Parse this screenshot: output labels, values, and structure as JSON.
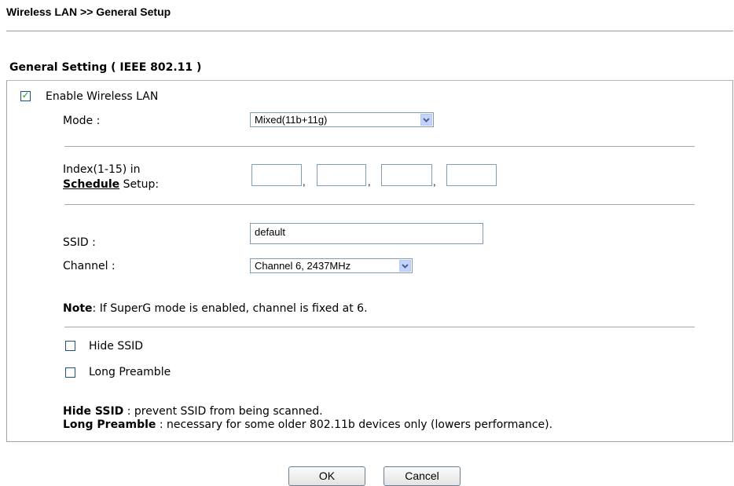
{
  "breadcrumb": "Wireless LAN >> General Setup",
  "section_title": "General Setting ( IEEE 802.11 )",
  "enable_wlan": {
    "label": "Enable Wireless LAN",
    "checked": true
  },
  "mode": {
    "label": "Mode :",
    "value": "Mixed(11b+11g)"
  },
  "schedule": {
    "label_line1": "Index(1-15) in",
    "label_link": "Schedule",
    "label_rest": " Setup:",
    "indexes": [
      "",
      "",
      "",
      ""
    ],
    "separator": ","
  },
  "ssid": {
    "label": "SSID :",
    "value": "default"
  },
  "channel": {
    "label": "Channel :",
    "value": "Channel 6, 2437MHz"
  },
  "note": {
    "bold": "Note",
    "text": ": If SuperG mode is enabled, channel is fixed at 6."
  },
  "hide_ssid": {
    "label": "Hide SSID",
    "checked": false
  },
  "long_preamble": {
    "label": "Long Preamble",
    "checked": false
  },
  "help": {
    "hide_ssid_term": "Hide SSID",
    "hide_ssid_desc": " : prevent SSID from being scanned.",
    "long_preamble_term": "Long Preamble",
    "long_preamble_desc": " : necessary for some older 802.11b devices only (lowers performance)."
  },
  "buttons": {
    "ok": "OK",
    "cancel": "Cancel"
  },
  "colors": {
    "checkmark": "#21a121",
    "input_border": "#7f9db9",
    "dropdown_button": "#c3d3fd"
  },
  "icons": {
    "dropdown": "chevron-down-icon",
    "check": "check-icon"
  }
}
